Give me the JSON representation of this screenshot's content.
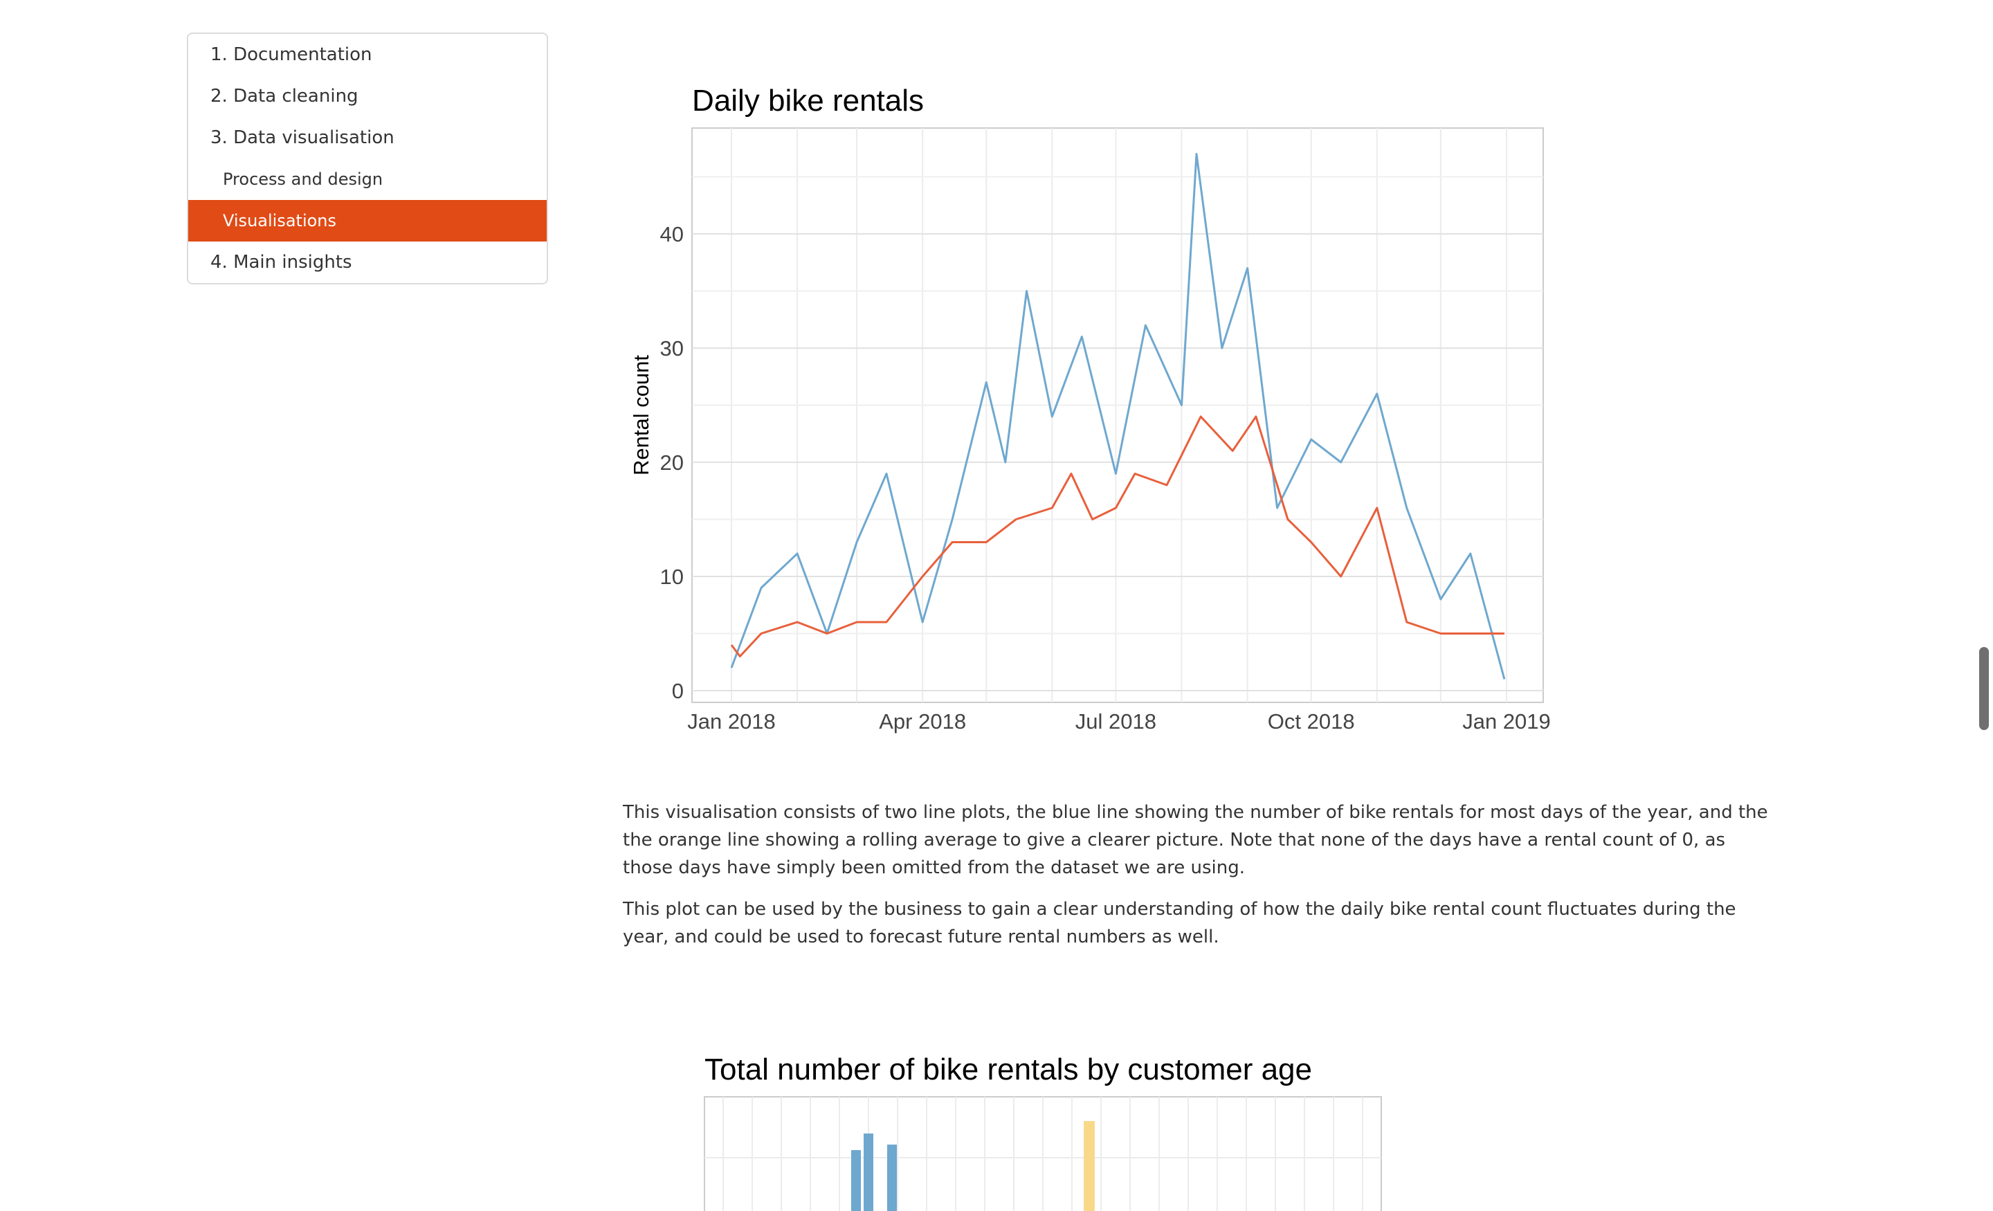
{
  "toc": {
    "items": [
      {
        "label": "1. Documentation",
        "level": 1,
        "active": false
      },
      {
        "label": "2. Data cleaning",
        "level": 1,
        "active": false
      },
      {
        "label": "3. Data visualisation",
        "level": 1,
        "active": false
      },
      {
        "label": "Process and design",
        "level": 2,
        "active": false
      },
      {
        "label": "Visualisations",
        "level": 2,
        "active": true
      },
      {
        "label": "4. Main insights",
        "level": 1,
        "active": false
      }
    ],
    "accent_color": "#e04b16"
  },
  "chart_data": [
    {
      "type": "line",
      "title": "Daily bike rentals",
      "xlabel": "",
      "ylabel": "Rental count",
      "x_ticks": [
        "Jan 2018",
        "Apr 2018",
        "Jul 2018",
        "Oct 2018",
        "Jan 2019"
      ],
      "y_ticks": [
        0,
        10,
        20,
        30,
        40
      ],
      "xlim": [
        "2018-01-01",
        "2019-01-01"
      ],
      "ylim": [
        0,
        47
      ],
      "grid": true,
      "series": [
        {
          "color": "#6fa8cf",
          "x": [
            "2018-01-01",
            "2018-01-15",
            "2018-02-01",
            "2018-02-15",
            "2018-03-01",
            "2018-03-15",
            "2018-04-01",
            "2018-04-15",
            "2018-05-01",
            "2018-05-10",
            "2018-05-20",
            "2018-06-01",
            "2018-06-15",
            "2018-07-01",
            "2018-07-15",
            "2018-08-01",
            "2018-08-08",
            "2018-08-20",
            "2018-09-01",
            "2018-09-15",
            "2018-10-01",
            "2018-10-15",
            "2018-11-01",
            "2018-11-15",
            "2018-12-01",
            "2018-12-15",
            "2018-12-31"
          ],
          "y": [
            2,
            9,
            12,
            5,
            13,
            19,
            6,
            15,
            27,
            20,
            35,
            24,
            31,
            19,
            32,
            25,
            47,
            30,
            37,
            16,
            22,
            20,
            26,
            16,
            8,
            12,
            1
          ]
        },
        {
          "color": "#e8603c",
          "x": [
            "2018-01-01",
            "2018-01-05",
            "2018-01-15",
            "2018-02-01",
            "2018-02-15",
            "2018-03-01",
            "2018-03-15",
            "2018-04-01",
            "2018-04-15",
            "2018-05-01",
            "2018-05-15",
            "2018-06-01",
            "2018-06-10",
            "2018-06-20",
            "2018-07-01",
            "2018-07-10",
            "2018-07-25",
            "2018-08-10",
            "2018-08-25",
            "2018-09-05",
            "2018-09-20",
            "2018-10-01",
            "2018-10-15",
            "2018-11-01",
            "2018-11-15",
            "2018-12-01",
            "2018-12-15",
            "2018-12-31"
          ],
          "y": [
            4,
            3,
            5,
            6,
            5,
            6,
            6,
            10,
            13,
            13,
            15,
            16,
            19,
            15,
            16,
            19,
            18,
            24,
            21,
            24,
            15,
            13,
            10,
            16,
            6,
            5,
            5,
            5
          ]
        }
      ]
    },
    {
      "type": "bar",
      "title": "Total number of bike rentals by customer age",
      "partially_visible": true,
      "colors": [
        "#6fa8cf",
        "#f8d98a"
      ]
    }
  ],
  "paragraphs": [
    "This visualisation consists of two line plots, the blue line showing the number of bike rentals for most days of the year, and the the orange line showing a rolling average to give a clearer picture. Note that none of the days have a rental count of 0, as those days have simply been omitted from the dataset we are using.",
    "This plot can be used by the business to gain a clear understanding of how the daily bike rental count fluctuates during the year, and could be used to forecast future rental numbers as well."
  ]
}
